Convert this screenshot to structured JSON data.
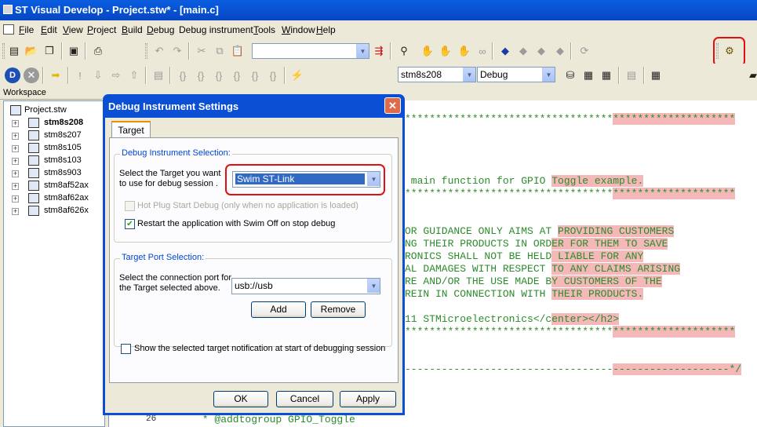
{
  "window_title": "ST Visual Develop - Project.stw* - [main.c]",
  "menu": [
    {
      "label": "File",
      "key": "F",
      "rest": "ile"
    },
    {
      "label": "Edit",
      "key": "E",
      "rest": "dit"
    },
    {
      "label": "View",
      "key": "V",
      "rest": "iew"
    },
    {
      "label": "Project",
      "key": "P",
      "rest": "roject"
    },
    {
      "label": "Build",
      "key": "B",
      "rest": "uild"
    },
    {
      "label": "Debug",
      "key": "D",
      "rest": "ebug"
    },
    {
      "label": "Debug instrument",
      "key": "",
      "rest": "Debug instrument"
    },
    {
      "label": "Tools",
      "key": "T",
      "rest": "ools"
    },
    {
      "label": "Window",
      "key": "W",
      "rest": "indow"
    },
    {
      "label": "Help",
      "key": "H",
      "rest": "elp"
    }
  ],
  "toolbar": {
    "search_value": "",
    "target_combo": "stm8s208",
    "config_combo": "Debug"
  },
  "workspace": {
    "label": "Workspace",
    "root": "Project.stw",
    "projects": [
      "stm8s208",
      "stm8s207",
      "stm8s105",
      "stm8s103",
      "stm8s903",
      "stm8af52ax",
      "stm8af62ax",
      "stm8af626x"
    ],
    "active_project": "stm8s208"
  },
  "editor": {
    "lines": [
      {
        "pre": "**********************************",
        "hl": "********************"
      },
      {
        "pre": " main function for GPIO ",
        "hl": "Toggle example."
      },
      {
        "pre": "**********************************",
        "hl": "********************"
      },
      {
        "pre": "OR GUIDANCE ONLY AIMS AT ",
        "hl": "PROVIDING CUSTOMERS"
      },
      {
        "pre": "NG THEIR PRODUCTS IN ORD",
        "hl": "ER FOR THEM TO SAVE"
      },
      {
        "pre": "RONICS SHALL NOT BE HELD",
        "hl": " LIABLE FOR ANY"
      },
      {
        "pre": "AL DAMAGES WITH RESPECT ",
        "hl": "TO ANY CLAIMS ARISING"
      },
      {
        "pre": "RE AND/OR THE USE MADE B",
        "hl": "Y CUSTOMERS OF THE"
      },
      {
        "pre": "REIN IN CONNECTION WITH ",
        "hl": "THEIR PRODUCTS."
      },
      {
        "pre": "11 STMicroelectronics</c",
        "hl": "enter></h2>"
      },
      {
        "pre": "**********************************",
        "hl": "********************"
      },
      {
        "pre": "----------------------------------",
        "hl": "-------------------*/"
      },
      {
        "pre": " * @addtogroup GPIO_Toggle",
        "hl": ""
      }
    ],
    "line_number": "26"
  },
  "dialog": {
    "title": "Debug Instrument Settings",
    "tab": "Target",
    "instrument_group": "Debug Instrument Selection:",
    "target_prompt_1": "Select the Target you want",
    "target_prompt_2": "to use for debug session .",
    "target_value": "Swim ST-Link",
    "hot_plug_label": "Hot Plug Start Debug (only when no application is loaded)",
    "hot_plug_checked": false,
    "restart_label": "Restart the application with Swim Off on stop debug",
    "restart_checked": true,
    "port_group": "Target Port Selection:",
    "port_prompt_1": "Select the connection port for",
    "port_prompt_2": "the Target selected above.",
    "port_value": "usb://usb",
    "add_label": "Add",
    "remove_label": "Remove",
    "notify_label": "Show the selected target notification at start of debugging session",
    "notify_checked": false,
    "ok_label": "OK",
    "cancel_label": "Cancel",
    "apply_label": "Apply"
  },
  "colors": {
    "title_bar": "#0853d4",
    "highlight": "#f4b8b8",
    "code_green": "#2c8b2c",
    "annotation_red": "#e01010"
  }
}
